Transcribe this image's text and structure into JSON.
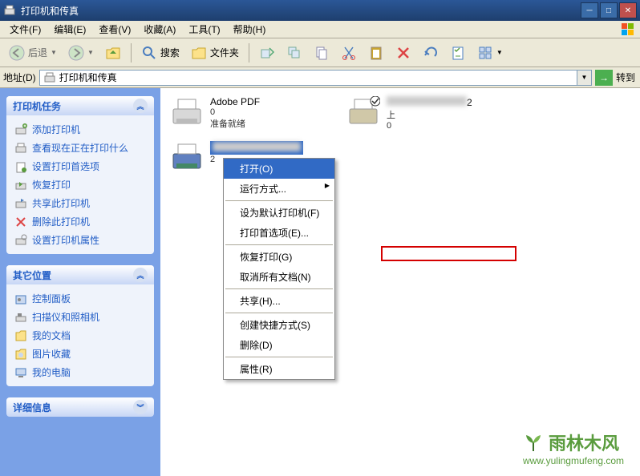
{
  "window": {
    "title": "打印机和传真"
  },
  "menubar": {
    "file": "文件(F)",
    "edit": "编辑(E)",
    "view": "查看(V)",
    "favorites": "收藏(A)",
    "tools": "工具(T)",
    "help": "帮助(H)"
  },
  "toolbar": {
    "back": "后退",
    "search": "搜索",
    "folders": "文件夹"
  },
  "addressbar": {
    "label": "地址(D)",
    "value": "打印机和传真",
    "go": "转到"
  },
  "sidebar": {
    "tasks": {
      "title": "打印机任务",
      "items": [
        {
          "label": "添加打印机"
        },
        {
          "label": "查看现在正在打印什么"
        },
        {
          "label": "设置打印首选项"
        },
        {
          "label": "恢复打印"
        },
        {
          "label": "共享此打印机"
        },
        {
          "label": "删除此打印机"
        },
        {
          "label": "设置打印机属性"
        }
      ]
    },
    "other": {
      "title": "其它位置",
      "items": [
        {
          "label": "控制面板"
        },
        {
          "label": "扫描仪和照相机"
        },
        {
          "label": "我的文档"
        },
        {
          "label": "图片收藏"
        },
        {
          "label": "我的电脑"
        }
      ]
    },
    "details": {
      "title": "详细信息"
    }
  },
  "printers": [
    {
      "name": "Adobe PDF",
      "docs": "0",
      "status": "准备就绪"
    },
    {
      "name": "",
      "docs": "0",
      "status": "上",
      "suffix": "2"
    },
    {
      "name": "",
      "docs": "2",
      "status": ""
    }
  ],
  "context_menu": {
    "open": "打开(O)",
    "runas": "运行方式...",
    "setdefault": "设为默认打印机(F)",
    "prefs": "打印首选项(E)...",
    "resume": "恢复打印(G)",
    "cancel": "取消所有文档(N)",
    "share": "共享(H)...",
    "shortcut": "创建快捷方式(S)",
    "delete": "删除(D)",
    "props": "属性(R)"
  },
  "watermark": {
    "brand": "雨林木风",
    "url": "www.yulingmufeng.com"
  }
}
